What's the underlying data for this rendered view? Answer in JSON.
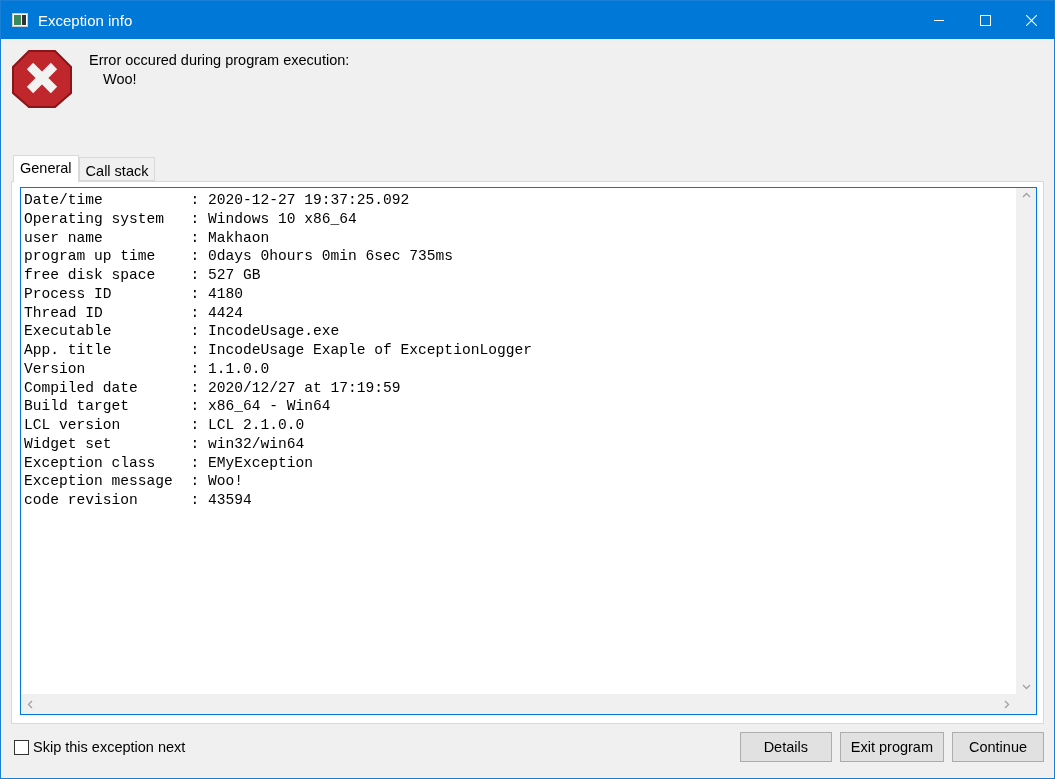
{
  "window": {
    "title": "Exception info"
  },
  "message": {
    "heading": "Error occured during program execution:",
    "text": "Woo!"
  },
  "tabs": [
    {
      "label": "General",
      "selected": true
    },
    {
      "label": "Call stack",
      "selected": false
    }
  ],
  "details_lines": [
    "Date/time          : 2020-12-27 19:37:25.092",
    "Operating system   : Windows 10 x86_64",
    "user name          : Makhaon",
    "program up time    : 0days 0hours 0min 6sec 735ms",
    "free disk space    : 527 GB",
    "Process ID         : 4180",
    "Thread ID          : 4424",
    "Executable         : IncodeUsage.exe",
    "App. title         : IncodeUsage Exaple of ExceptionLogger",
    "Version            : 1.1.0.0",
    "Compiled date      : 2020/12/27 at 17:19:59",
    "Build target       : x86_64 - Win64",
    "LCL version        : LCL 2.1.0.0",
    "Widget set         : win32/win64",
    "Exception class    : EMyException",
    "Exception message  : Woo!",
    "code revision      : 43594"
  ],
  "skip_checkbox": {
    "label": "Skip this exception next",
    "checked": false
  },
  "buttons": [
    "Details",
    "Exit program",
    "Continue"
  ]
}
